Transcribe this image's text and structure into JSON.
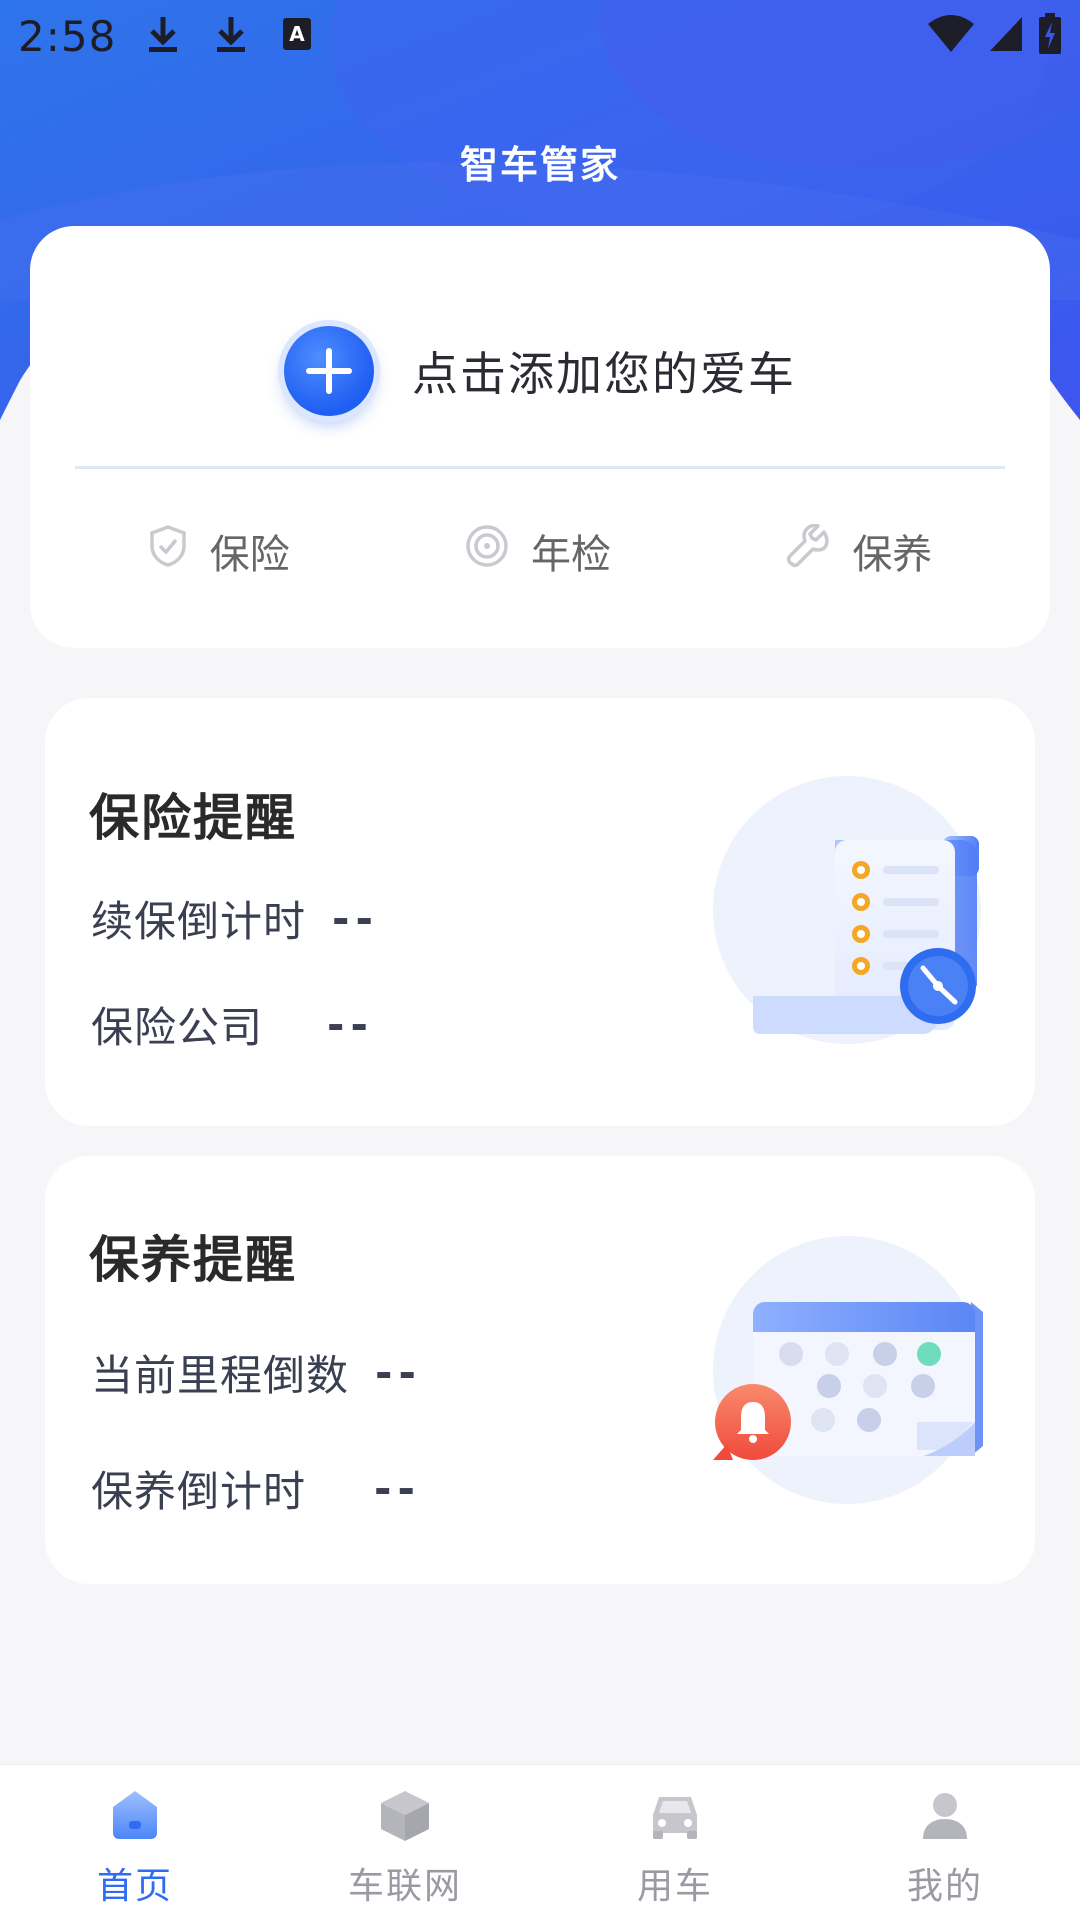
{
  "status_bar": {
    "time": "2:58",
    "left_icons": [
      "download-icon",
      "download-icon",
      "keyboard-a-icon"
    ],
    "right_icons": [
      "wifi-icon",
      "signal-icon",
      "battery-charging-icon"
    ]
  },
  "header": {
    "title": "智车管家"
  },
  "car_card": {
    "add_car_label": "点击添加您的爱车",
    "services": [
      {
        "label": "保险",
        "icon": "shield-check-icon"
      },
      {
        "label": "年检",
        "icon": "target-icon"
      },
      {
        "label": "保养",
        "icon": "wrench-icon"
      }
    ]
  },
  "insurance_reminder": {
    "title": "保险提醒",
    "rows": [
      {
        "label": "续保倒计时",
        "value": "--"
      },
      {
        "label": "保险公司",
        "value": "--"
      }
    ]
  },
  "maintenance_reminder": {
    "title": "保养提醒",
    "rows": [
      {
        "label": "当前里程倒数",
        "value": "--"
      },
      {
        "label": "保养倒计时",
        "value": "--"
      }
    ]
  },
  "bottom_nav": {
    "items": [
      {
        "label": "首页",
        "icon": "home-icon",
        "active": true
      },
      {
        "label": "车联网",
        "icon": "cube-icon",
        "active": false
      },
      {
        "label": "用车",
        "icon": "car-icon",
        "active": false
      },
      {
        "label": "我的",
        "icon": "user-icon",
        "active": false
      }
    ]
  },
  "colors": {
    "brand_blue": "#2f6cf6",
    "header_gradient_start": "#2b6fe8",
    "header_gradient_end": "#3f5ef0",
    "background": "#f6f6f8",
    "accent_orange": "#f5a623",
    "alert_red": "#f26a4b"
  }
}
